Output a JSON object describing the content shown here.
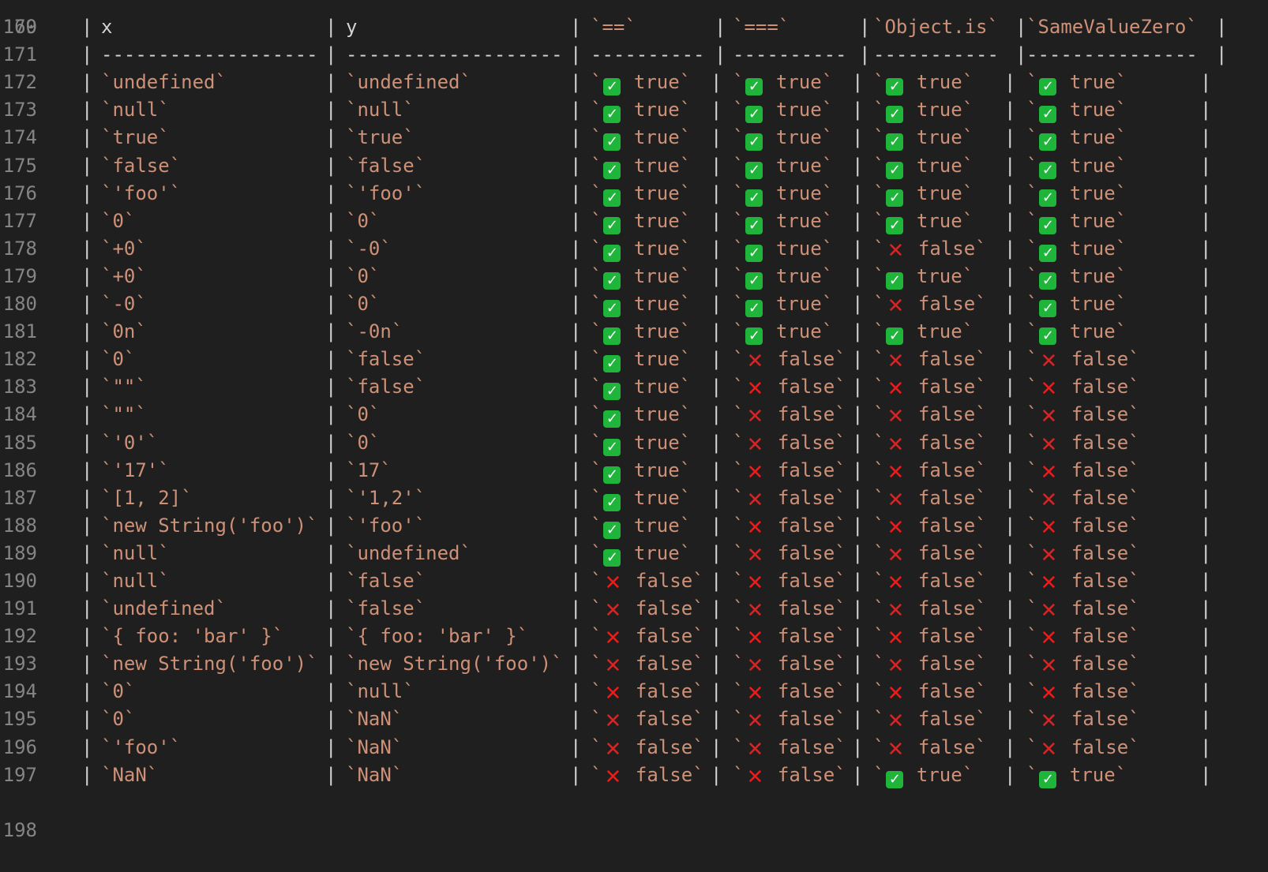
{
  "editor": {
    "top_line_number": "169",
    "bottom_line_number": "198",
    "header": {
      "line_number": "170",
      "cells": [
        "x",
        "y",
        "`==`",
        "`===`",
        "`Object.is`",
        "`SameValueZero`"
      ]
    },
    "separator": {
      "line_number": "171",
      "cells": [
        "-------------------",
        "-------------------",
        "----------",
        "----------",
        "-----------",
        "---------------"
      ]
    },
    "rows": [
      {
        "n": "172",
        "x": "`undefined`",
        "y": "`undefined`",
        "eq": true,
        "seq": true,
        "is": true,
        "svz": true
      },
      {
        "n": "173",
        "x": "`null`",
        "y": "`null`",
        "eq": true,
        "seq": true,
        "is": true,
        "svz": true
      },
      {
        "n": "174",
        "x": "`true`",
        "y": "`true`",
        "eq": true,
        "seq": true,
        "is": true,
        "svz": true
      },
      {
        "n": "175",
        "x": "`false`",
        "y": "`false`",
        "eq": true,
        "seq": true,
        "is": true,
        "svz": true
      },
      {
        "n": "176",
        "x": "`'foo'`",
        "y": "`'foo'`",
        "eq": true,
        "seq": true,
        "is": true,
        "svz": true
      },
      {
        "n": "177",
        "x": "`0`",
        "y": "`0`",
        "eq": true,
        "seq": true,
        "is": true,
        "svz": true
      },
      {
        "n": "178",
        "x": "`+0`",
        "y": "`-0`",
        "eq": true,
        "seq": true,
        "is": false,
        "svz": true
      },
      {
        "n": "179",
        "x": "`+0`",
        "y": "`0`",
        "eq": true,
        "seq": true,
        "is": true,
        "svz": true
      },
      {
        "n": "180",
        "x": "`-0`",
        "y": "`0`",
        "eq": true,
        "seq": true,
        "is": false,
        "svz": true
      },
      {
        "n": "181",
        "x": "`0n`",
        "y": "`-0n`",
        "eq": true,
        "seq": true,
        "is": true,
        "svz": true
      },
      {
        "n": "182",
        "x": "`0`",
        "y": "`false`",
        "eq": true,
        "seq": false,
        "is": false,
        "svz": false
      },
      {
        "n": "183",
        "x": "`\"\"`",
        "y": "`false`",
        "eq": true,
        "seq": false,
        "is": false,
        "svz": false
      },
      {
        "n": "184",
        "x": "`\"\"`",
        "y": "`0`",
        "eq": true,
        "seq": false,
        "is": false,
        "svz": false
      },
      {
        "n": "185",
        "x": "`'0'`",
        "y": "`0`",
        "eq": true,
        "seq": false,
        "is": false,
        "svz": false
      },
      {
        "n": "186",
        "x": "`'17'`",
        "y": "`17`",
        "eq": true,
        "seq": false,
        "is": false,
        "svz": false
      },
      {
        "n": "187",
        "x": "`[1, 2]`",
        "y": "`'1,2'`",
        "eq": true,
        "seq": false,
        "is": false,
        "svz": false
      },
      {
        "n": "188",
        "x": "`new String('foo')`",
        "y": "`'foo'`",
        "eq": true,
        "seq": false,
        "is": false,
        "svz": false
      },
      {
        "n": "189",
        "x": "`null`",
        "y": "`undefined`",
        "eq": true,
        "seq": false,
        "is": false,
        "svz": false
      },
      {
        "n": "190",
        "x": "`null`",
        "y": "`false`",
        "eq": false,
        "seq": false,
        "is": false,
        "svz": false
      },
      {
        "n": "191",
        "x": "`undefined`",
        "y": "`false`",
        "eq": false,
        "seq": false,
        "is": false,
        "svz": false
      },
      {
        "n": "192",
        "x": "`{ foo: 'bar' }`",
        "y": "`{ foo: 'bar' }`",
        "eq": false,
        "seq": false,
        "is": false,
        "svz": false
      },
      {
        "n": "193",
        "x": "`new String('foo')`",
        "y": "`new String('foo')`",
        "eq": false,
        "seq": false,
        "is": false,
        "svz": false
      },
      {
        "n": "194",
        "x": "`0`",
        "y": "`null`",
        "eq": false,
        "seq": false,
        "is": false,
        "svz": false
      },
      {
        "n": "195",
        "x": "`0`",
        "y": "`NaN`",
        "eq": false,
        "seq": false,
        "is": false,
        "svz": false
      },
      {
        "n": "196",
        "x": "`'foo'`",
        "y": "`NaN`",
        "eq": false,
        "seq": false,
        "is": false,
        "svz": false
      },
      {
        "n": "197",
        "x": "`NaN`",
        "y": "`NaN`",
        "eq": false,
        "seq": false,
        "is": true,
        "svz": true
      }
    ],
    "labels": {
      "true_text": "true",
      "false_text": "false",
      "pipe": "|",
      "backtick": "`"
    },
    "icons": {
      "true_icon": "white-check-mark-icon",
      "false_icon": "cross-mark-icon"
    },
    "colors": {
      "background": "#1f1f1f",
      "line_number": "#858585",
      "string": "#ce9178",
      "text": "#d4d4d4",
      "check_green": "#1fb53a",
      "cross_red": "#e31f1f"
    }
  }
}
